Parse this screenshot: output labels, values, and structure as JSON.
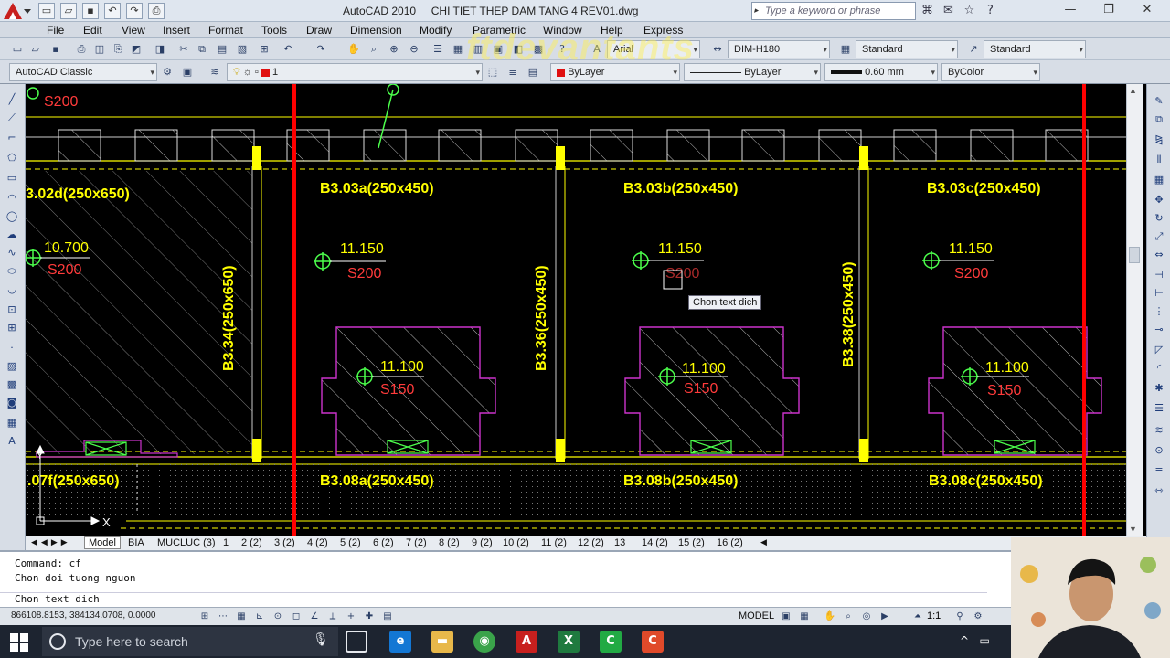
{
  "app": {
    "title": "AutoCAD 2010",
    "document": "CHI TIET THEP DAM TANG 4 REV01.dwg",
    "search_placeholder": "Type a keyword or phrase"
  },
  "menu": [
    "File",
    "Edit",
    "View",
    "Insert",
    "Format",
    "Tools",
    "Draw",
    "Dimension",
    "Modify",
    "Parametric",
    "Window",
    "Help",
    "Express"
  ],
  "toolbar": {
    "font_combo": "Arial",
    "dimstyle_combo": "DIM-H180",
    "tablestyle_combo": "Standard",
    "multileader_combo": "Standard",
    "workspace_combo": "AutoCAD Classic",
    "layer_combo": "1",
    "color_combo": "ByLayer",
    "linetype_combo": "ByLayer",
    "lineweight_combo": "0.60 mm",
    "plotstyle_combo": "ByColor"
  },
  "watermark": "ftdevantants",
  "colors": {
    "beam": "#ffff00",
    "grid": "#ff0000",
    "section": "#cc33cc",
    "label_red": "#ff3b3b",
    "marker": "#4cff4c"
  },
  "drawing": {
    "top_row_labels": [
      "B3.03a(250x450)",
      "B3.03b(250x450)",
      "B3.03c(250x450)"
    ],
    "top_left_label": "3.02d(250x650)",
    "bottom_row_labels": [
      "B3.08a(250x450)",
      "B3.08b(250x450)",
      "B3.08c(250x450)"
    ],
    "bottom_left_label": ".07f(250x650)",
    "vertical_labels": [
      "B3.34(250x650)",
      "B3.36(250x450)",
      "B3.38(250x450)"
    ],
    "slab_levels": [
      {
        "level": "10.700",
        "thickness": "S200"
      },
      {
        "level": "11.150",
        "thickness": "S200"
      },
      {
        "level": "11.150",
        "thickness": "S200"
      },
      {
        "level": "11.150",
        "thickness": "S200"
      }
    ],
    "section_levels": [
      {
        "level": "11.100",
        "thickness": "S150"
      },
      {
        "level": "11.100",
        "thickness": "S150"
      },
      {
        "level": "11.100",
        "thickness": "S150"
      }
    ],
    "top_fragment_label": "S200",
    "tooltip": "Chon text dich",
    "ucs_x": "X",
    "ucs_y": "Y"
  },
  "layout_tabs": [
    "Model",
    "BIA",
    "MUCLUC (3)",
    "1",
    "2 (2)",
    "3 (2)",
    "4 (2)",
    "5 (2)",
    "6 (2)",
    "7 (2)",
    "8 (2)",
    "9 (2)",
    "10 (2)",
    "11 (2)",
    "12 (2)",
    "13",
    "14 (2)",
    "15 (2)",
    "16 (2)"
  ],
  "command_lines": [
    "Command: cf",
    "Chon doi tuong nguon",
    "Chon text dich"
  ],
  "status": {
    "coordinates": "866108.8153, 384134.0708, 0.0000",
    "space": "MODEL",
    "scale": "1:1"
  },
  "taskbar": {
    "search_placeholder": "Type here to search"
  }
}
